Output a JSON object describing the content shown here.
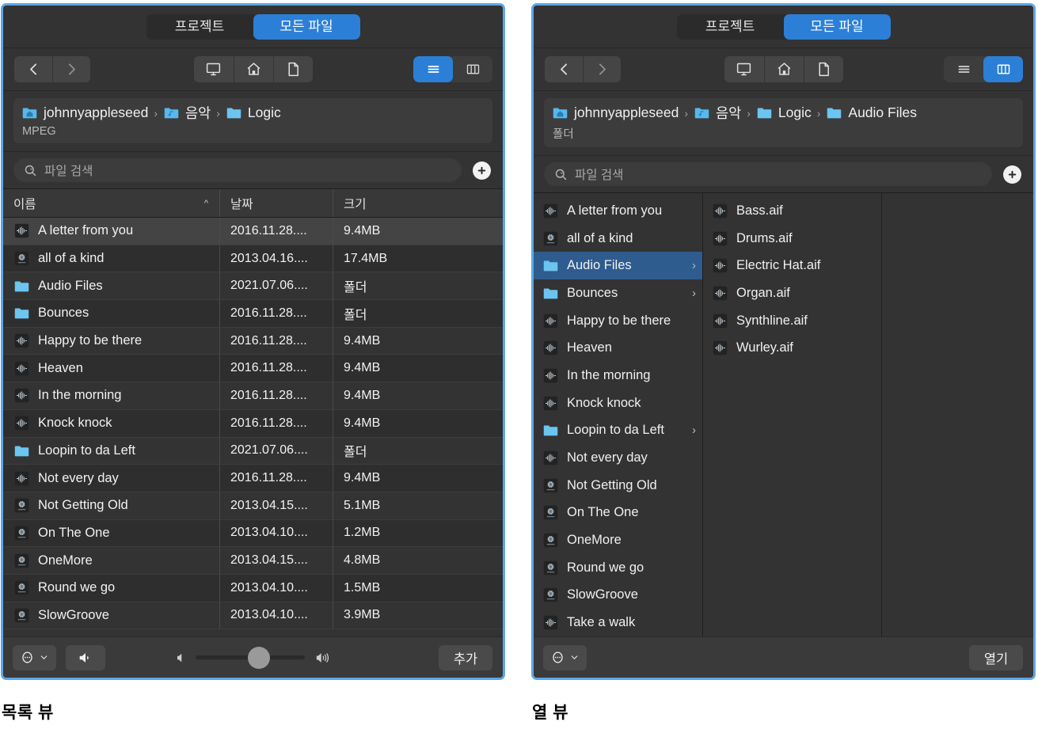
{
  "tabs": {
    "project": "프로젝트",
    "all_files": "모든 파일",
    "active": "모든 파일"
  },
  "toolbar": {
    "back_icon": "chevron-left-icon",
    "forward_icon": "chevron-right-icon",
    "computer_icon": "display-icon",
    "home_icon": "house-icon",
    "document_icon": "document-icon",
    "list_view_icon": "list-view-icon",
    "column_view_icon": "column-view-icon"
  },
  "search": {
    "placeholder": "파일 검색",
    "value": "",
    "icon": "search-icon",
    "add_icon": "plus-icon"
  },
  "left_panel": {
    "caption": "목록 뷰",
    "breadcrumb": [
      {
        "label": "johnnyappleseed",
        "icon": "home-folder-icon"
      },
      {
        "label": "음악",
        "icon": "music-folder-icon"
      },
      {
        "label": "Logic",
        "icon": "folder-icon"
      }
    ],
    "kind": "MPEG",
    "columns": {
      "name": "이름",
      "date": "날짜",
      "size": "크기"
    },
    "sort": {
      "column": "이름",
      "direction": "asc",
      "arrow": "^"
    },
    "rows": [
      {
        "name": "A letter from you",
        "date": "2016.11.28....",
        "size": "9.4MB",
        "icon": "audio-file-icon",
        "selected": true
      },
      {
        "name": "all of a kind",
        "date": "2013.04.16....",
        "size": "17.4MB",
        "icon": "project-file-icon",
        "selected": false
      },
      {
        "name": "Audio Files",
        "date": "2021.07.06....",
        "size": "폴더",
        "icon": "folder-icon",
        "selected": false
      },
      {
        "name": "Bounces",
        "date": "2016.11.28....",
        "size": "폴더",
        "icon": "folder-icon",
        "selected": false
      },
      {
        "name": "Happy to be there",
        "date": "2016.11.28....",
        "size": "9.4MB",
        "icon": "audio-file-icon",
        "selected": false
      },
      {
        "name": "Heaven",
        "date": "2016.11.28....",
        "size": "9.4MB",
        "icon": "audio-file-icon",
        "selected": false
      },
      {
        "name": "In the morning",
        "date": "2016.11.28....",
        "size": "9.4MB",
        "icon": "audio-file-icon",
        "selected": false
      },
      {
        "name": "Knock knock",
        "date": "2016.11.28....",
        "size": "9.4MB",
        "icon": "audio-file-icon",
        "selected": false
      },
      {
        "name": "Loopin to da Left",
        "date": "2021.07.06....",
        "size": "폴더",
        "icon": "folder-icon",
        "selected": false
      },
      {
        "name": "Not every day",
        "date": "2016.11.28....",
        "size": "9.4MB",
        "icon": "audio-file-icon",
        "selected": false
      },
      {
        "name": "Not Getting Old",
        "date": "2013.04.15....",
        "size": "5.1MB",
        "icon": "project-file-icon",
        "selected": false
      },
      {
        "name": "On The One",
        "date": "2013.04.10....",
        "size": "1.2MB",
        "icon": "project-file-icon",
        "selected": false
      },
      {
        "name": "OneMore",
        "date": "2013.04.15....",
        "size": "4.8MB",
        "icon": "project-file-icon",
        "selected": false
      },
      {
        "name": "Round we go",
        "date": "2013.04.10....",
        "size": "1.5MB",
        "icon": "project-file-icon",
        "selected": false
      },
      {
        "name": "SlowGroove",
        "date": "2013.04.10....",
        "size": "3.9MB",
        "icon": "project-file-icon",
        "selected": false
      }
    ],
    "bottom": {
      "more_icon": "more-options-icon",
      "more_chevron": "chevron-down-icon",
      "speaker_icon": "speaker-play-icon",
      "volume_low_icon": "volume-low-icon",
      "volume_high_icon": "volume-high-icon",
      "volume_percent": 58,
      "action_label": "추가"
    }
  },
  "right_panel": {
    "caption": "열 뷰",
    "breadcrumb": [
      {
        "label": "johnnyappleseed",
        "icon": "home-folder-icon"
      },
      {
        "label": "음악",
        "icon": "music-folder-icon"
      },
      {
        "label": "Logic",
        "icon": "folder-icon"
      },
      {
        "label": "Audio Files",
        "icon": "folder-icon"
      }
    ],
    "kind": "폴더",
    "column1": [
      {
        "name": "A letter from you",
        "icon": "audio-file-icon",
        "folder": false,
        "selected": false
      },
      {
        "name": "all of a kind",
        "icon": "project-file-icon",
        "folder": false,
        "selected": false
      },
      {
        "name": "Audio Files",
        "icon": "folder-icon",
        "folder": true,
        "selected": true
      },
      {
        "name": "Bounces",
        "icon": "folder-icon",
        "folder": true,
        "selected": false
      },
      {
        "name": "Happy to be there",
        "icon": "audio-file-icon",
        "folder": false,
        "selected": false
      },
      {
        "name": "Heaven",
        "icon": "audio-file-icon",
        "folder": false,
        "selected": false
      },
      {
        "name": "In the morning",
        "icon": "audio-file-icon",
        "folder": false,
        "selected": false
      },
      {
        "name": "Knock knock",
        "icon": "audio-file-icon",
        "folder": false,
        "selected": false
      },
      {
        "name": "Loopin to da Left",
        "icon": "folder-icon",
        "folder": true,
        "selected": false
      },
      {
        "name": "Not every day",
        "icon": "audio-file-icon",
        "folder": false,
        "selected": false
      },
      {
        "name": "Not Getting Old",
        "icon": "project-file-icon",
        "folder": false,
        "selected": false
      },
      {
        "name": "On The One",
        "icon": "project-file-icon",
        "folder": false,
        "selected": false
      },
      {
        "name": "OneMore",
        "icon": "project-file-icon",
        "folder": false,
        "selected": false
      },
      {
        "name": "Round we go",
        "icon": "project-file-icon",
        "folder": false,
        "selected": false
      },
      {
        "name": "SlowGroove",
        "icon": "project-file-icon",
        "folder": false,
        "selected": false
      },
      {
        "name": "Take a walk",
        "icon": "audio-file-icon",
        "folder": false,
        "selected": false
      }
    ],
    "column2": [
      {
        "name": "Bass.aif",
        "icon": "audio-file-icon"
      },
      {
        "name": "Drums.aif",
        "icon": "audio-file-icon"
      },
      {
        "name": "Electric Hat.aif",
        "icon": "audio-file-icon"
      },
      {
        "name": "Organ.aif",
        "icon": "audio-file-icon"
      },
      {
        "name": "Synthline.aif",
        "icon": "audio-file-icon"
      },
      {
        "name": "Wurley.aif",
        "icon": "audio-file-icon"
      }
    ],
    "column3": [],
    "bottom": {
      "more_icon": "more-options-icon",
      "more_chevron": "chevron-down-icon",
      "action_label": "열기"
    }
  },
  "colors": {
    "accent": "#2c7fd6",
    "window_border": "#5ba7e8",
    "panel_bg": "#333333",
    "selected_row_column": "#2f5c8f",
    "selected_row_list": "#444444",
    "folder_blue": "#6bc5f0"
  }
}
